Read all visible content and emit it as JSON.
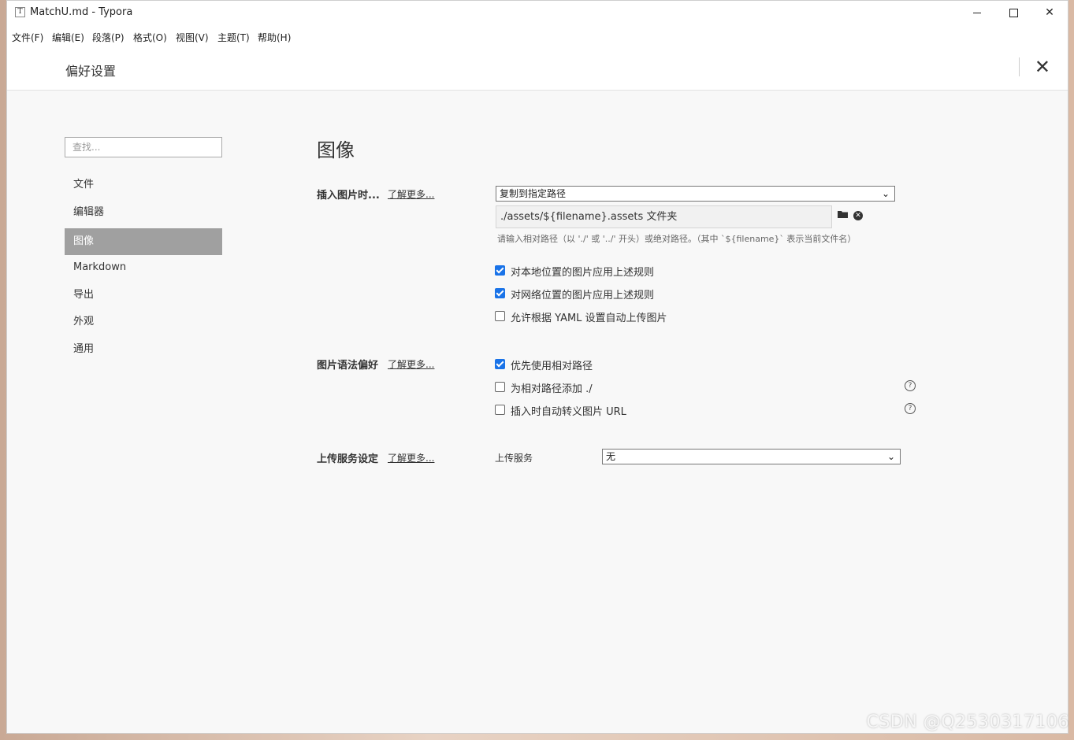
{
  "window": {
    "app_icon": "T",
    "title": "MatchU.md - Typora",
    "minimize_icon": "minimize-icon",
    "maximize_icon": "maximize-icon",
    "close_glyph": "✕"
  },
  "menu": [
    "文件(F)",
    "编辑(E)",
    "段落(P)",
    "格式(O)",
    "视图(V)",
    "主题(T)",
    "帮助(H)"
  ],
  "prefs": {
    "title": "偏好设置",
    "close_glyph": "✕"
  },
  "sidebar": {
    "search_placeholder": "查找...",
    "items": [
      {
        "label": "文件",
        "active": false
      },
      {
        "label": "编辑器",
        "active": false
      },
      {
        "label": "图像",
        "active": true
      },
      {
        "label": "Markdown",
        "active": false
      },
      {
        "label": "导出",
        "active": false
      },
      {
        "label": "外观",
        "active": false
      },
      {
        "label": "通用",
        "active": false
      }
    ]
  },
  "content": {
    "section_title": "图像",
    "learn_more": "了解更多...",
    "insert": {
      "label": "插入图片时...",
      "action_selected": "复制到指定路径",
      "path_value": "./assets/${filename}.assets 文件夹",
      "hint": "请输入相对路径（以 './' 或 '../' 开头）或绝对路径。（其中 `${filename}` 表示当前文件名）",
      "options": [
        {
          "label": "对本地位置的图片应用上述规则",
          "checked": true
        },
        {
          "label": "对网络位置的图片应用上述规则",
          "checked": true
        },
        {
          "label": "允许根据 YAML 设置自动上传图片",
          "checked": false
        }
      ]
    },
    "syntax": {
      "label": "图片语法偏好",
      "options": [
        {
          "label": "优先使用相对路径",
          "checked": true
        },
        {
          "label": "为相对路径添加 ./",
          "checked": false
        },
        {
          "label": "插入时自动转义图片 URL",
          "checked": false
        }
      ]
    },
    "upload": {
      "label": "上传服务设定",
      "service_label": "上传服务",
      "service_selected": "无"
    }
  },
  "watermark": "CSDN @Q2530317106",
  "colors": {
    "checkbox_on": "#1a73e8",
    "active_item_bg": "#a0a0a0"
  }
}
